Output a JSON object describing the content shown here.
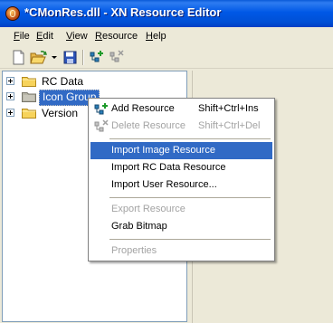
{
  "window": {
    "title": "*CMonRes.dll - XN Resource Editor"
  },
  "menubar": {
    "items": [
      {
        "mnemonic": "F",
        "rest": "ile"
      },
      {
        "mnemonic": "E",
        "rest": "dit"
      },
      {
        "mnemonic": "V",
        "rest": "iew"
      },
      {
        "mnemonic": "R",
        "rest": "esource"
      },
      {
        "mnemonic": "H",
        "rest": "elp"
      }
    ]
  },
  "toolbar": {
    "icons": [
      "new-document-icon",
      "open-folder-icon",
      "dropdown-arrow-icon",
      "save-icon",
      "add-resource-icon",
      "delete-resource-icon"
    ]
  },
  "tree": {
    "items": [
      {
        "label": "RC Data",
        "selected": false
      },
      {
        "label": "Icon Group",
        "selected": true
      },
      {
        "label": "Version",
        "selected": false
      }
    ]
  },
  "context_menu": {
    "items": [
      {
        "label": "Add Resource",
        "shortcut": "Shift+Ctrl+Ins",
        "enabled": true,
        "icon": "add-resource-icon"
      },
      {
        "label": "Delete Resource",
        "shortcut": "Shift+Ctrl+Del",
        "enabled": false,
        "icon": "delete-resource-icon"
      },
      {
        "label": "Import Image Resource",
        "shortcut": "",
        "enabled": true,
        "highlighted": true
      },
      {
        "label": "Import RC Data Resource",
        "shortcut": "",
        "enabled": true
      },
      {
        "label": "Import User Resource...",
        "shortcut": "",
        "enabled": true
      },
      {
        "label": "Export Resource",
        "shortcut": "",
        "enabled": false
      },
      {
        "label": "Grab Bitmap",
        "shortcut": "",
        "enabled": true
      },
      {
        "label": "Properties",
        "shortcut": "",
        "enabled": false
      }
    ]
  },
  "colors": {
    "titlebar": "#0058e6",
    "selection": "#316ac5",
    "disabled_text": "#a3a3a3",
    "folder": "#f7d35b"
  }
}
